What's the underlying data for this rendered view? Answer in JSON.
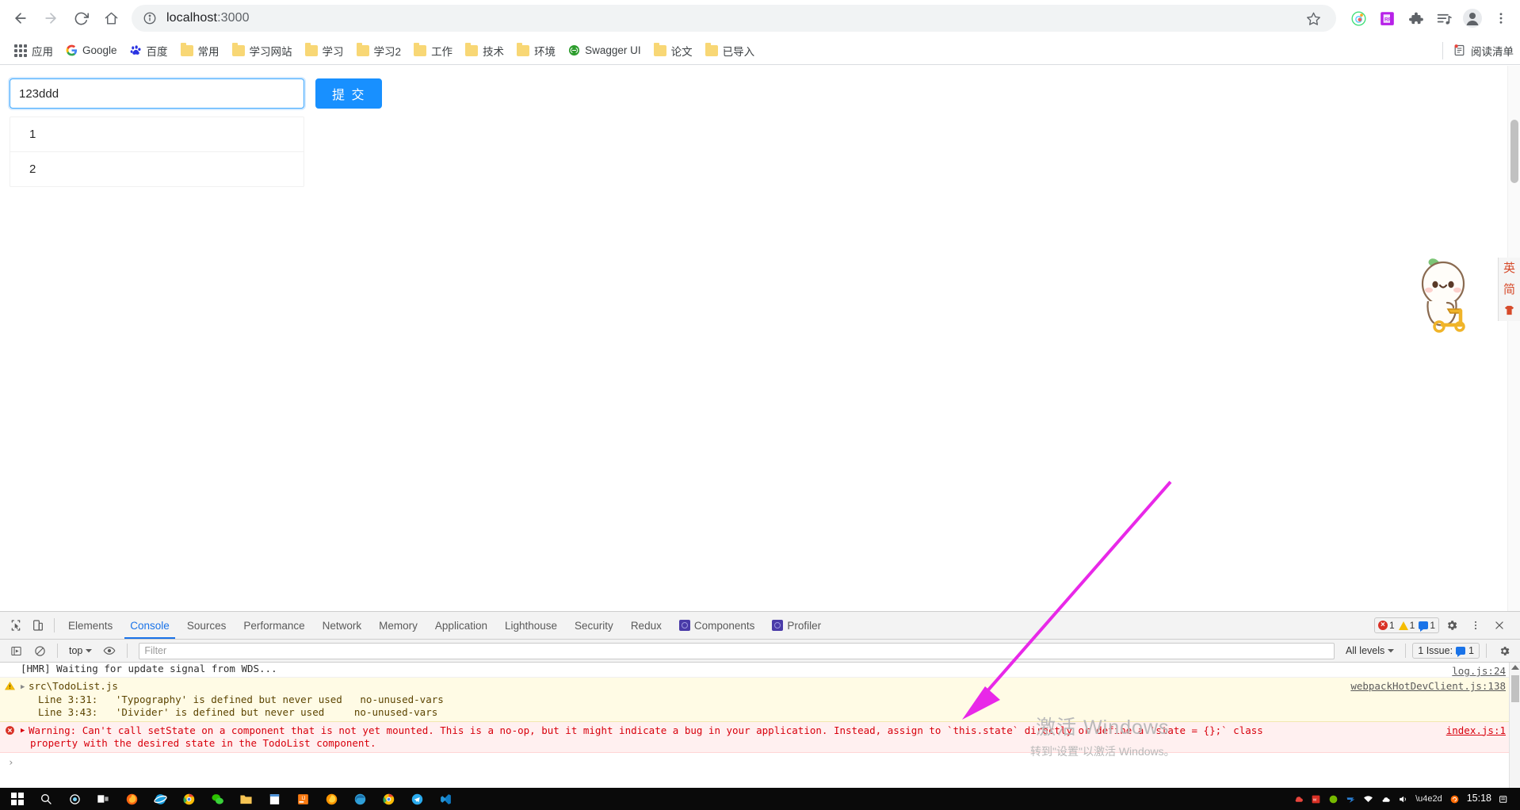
{
  "browser": {
    "url_host": "localhost",
    "url_port": ":3000",
    "back_label": "Back",
    "forward_label": "Forward",
    "reload_label": "Reload",
    "home_label": "Home",
    "info_icon": "info-circle-icon",
    "star_label": "Bookmark this tab",
    "extensions": [
      "eye-tracker-icon",
      "rp-axure-icon",
      "puzzle-extensions-icon",
      "media-list-icon",
      "profile-avatar-icon",
      "three-dot-menu-icon"
    ]
  },
  "bookmarks": {
    "apps_label": "应用",
    "items": [
      {
        "label": "Google",
        "icon": "google-icon"
      },
      {
        "label": "百度",
        "icon": "baidu-icon"
      },
      {
        "label": "常用",
        "icon": "folder-icon"
      },
      {
        "label": "学习网站",
        "icon": "folder-icon"
      },
      {
        "label": "学习",
        "icon": "folder-icon"
      },
      {
        "label": "学习2",
        "icon": "folder-icon"
      },
      {
        "label": "工作",
        "icon": "folder-icon"
      },
      {
        "label": "技术",
        "icon": "folder-icon"
      },
      {
        "label": "环境",
        "icon": "folder-icon"
      },
      {
        "label": "Swagger UI",
        "icon": "swagger-icon"
      },
      {
        "label": "论文",
        "icon": "folder-icon"
      },
      {
        "label": "已导入",
        "icon": "folder-icon"
      }
    ],
    "reading_list": "阅读清单"
  },
  "page": {
    "input_value": "123ddd",
    "input_placeholder": "",
    "submit_label": "提 交",
    "todos": [
      "1",
      "2"
    ]
  },
  "ime": {
    "lang": "英",
    "mode": "简",
    "skin": "skin-icon"
  },
  "devtools": {
    "inspect_icon": "inspect-element-icon",
    "device_icon": "device-toolbar-icon",
    "tabs": [
      {
        "label": "Elements",
        "active": false
      },
      {
        "label": "Console",
        "active": true
      },
      {
        "label": "Sources",
        "active": false
      },
      {
        "label": "Performance",
        "active": false
      },
      {
        "label": "Network",
        "active": false
      },
      {
        "label": "Memory",
        "active": false
      },
      {
        "label": "Application",
        "active": false
      },
      {
        "label": "Lighthouse",
        "active": false
      },
      {
        "label": "Security",
        "active": false
      },
      {
        "label": "Redux",
        "active": false
      },
      {
        "label": "Components",
        "active": false,
        "icon": "react-icon"
      },
      {
        "label": "Profiler",
        "active": false,
        "icon": "react-icon"
      }
    ],
    "counts": {
      "errors": "1",
      "warnings": "1",
      "messages": "1"
    },
    "settings_icon": "gear-icon",
    "more_icon": "three-dot-menu-icon",
    "close_icon": "close-icon",
    "console_toolbar": {
      "execute_icon": "execute-sidebar-icon",
      "clear_icon": "clear-console-icon",
      "context": "top",
      "eye_icon": "live-expression-eye-icon",
      "filter_placeholder": "Filter",
      "levels": "All levels",
      "issues": "1 Issue:",
      "issues_count": "1",
      "settings_icon": "gear-icon"
    },
    "messages": [
      {
        "type": "info",
        "text": "[HMR] Waiting for update signal from WDS...",
        "source": "log.js:24"
      },
      {
        "type": "warn",
        "text": "src\\TodoList.js",
        "lines": [
          {
            "loc": "Line 3:31:",
            "msg": "'Typography' is defined but never used",
            "rule": "no-unused-vars"
          },
          {
            "loc": "Line 3:43:",
            "msg": "'Divider' is defined but never used",
            "rule": "no-unused-vars"
          }
        ],
        "source": "webpackHotDevClient.js:138"
      },
      {
        "type": "error",
        "text": "Warning: Can't call setState on a component that is not yet mounted. This is a no-op, but it might indicate a bug in your application. Instead, assign to `this.state` directly or define a `state = {};` class",
        "text2": "property with the desired state in the TodoList component.",
        "source": "index.js:1"
      }
    ],
    "prompt": ""
  },
  "watermark": {
    "line1": "激活 Windows",
    "line2": "转到\"设置\"以激活 Windows。"
  },
  "taskbar": {
    "start_icon": "windows-start-icon",
    "items": [
      "search-icon",
      "cortana-icon",
      "task-view-icon",
      "firefox-icon",
      "ie-icon",
      "chrome-icon",
      "wechat-icon",
      "folder-icon",
      "notes-icon",
      "idea-icon",
      "firefox2-icon",
      "edge-icon",
      "chrome2-icon",
      "telegram-icon",
      "vscode-icon"
    ],
    "tray": [
      "cloud-icon",
      "wps-icon",
      "nvidia-icon",
      "xunlei-icon",
      "wifi-icon",
      "onedrive-icon",
      "volume-icon",
      "lang-icon",
      "sogou-icon"
    ],
    "time": "15:18",
    "notif_icon": "notification-icon"
  },
  "colors": {
    "accent_blue": "#1890ff",
    "devtools_tab_active": "#1a73e8",
    "error_red": "#d8000c",
    "warn_yellow": "#fffbe5",
    "arrow_pink": "#e828e8"
  }
}
